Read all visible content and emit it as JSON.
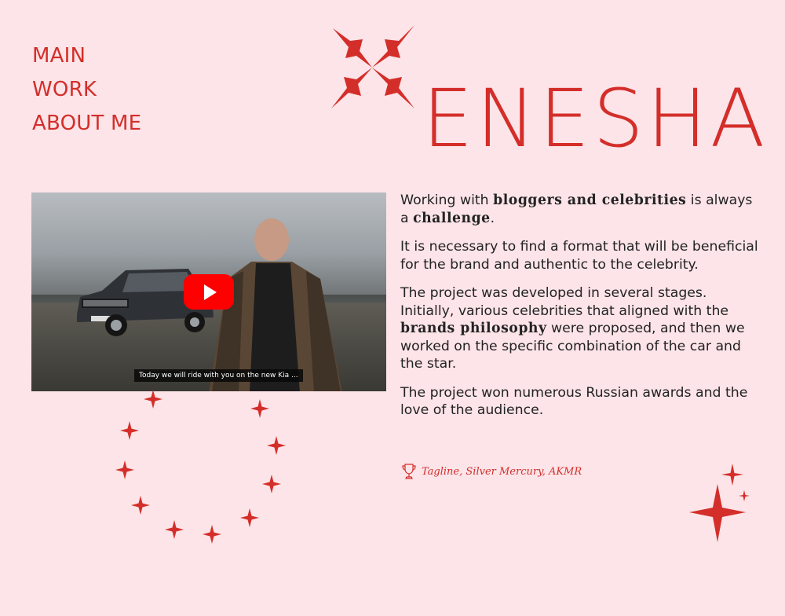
{
  "nav": {
    "items": [
      "MAIN",
      "WORK",
      "ABOUT ME"
    ]
  },
  "logo": {
    "text": "ENESHA",
    "icon": "four-sparkles-icon"
  },
  "video": {
    "caption": "Today we will ride with you on the new Kia ...",
    "play_icon": "youtube-play-icon"
  },
  "body": {
    "p1": {
      "a": "Working with ",
      "b": "bloggers and celebrities",
      "c": " is always a ",
      "d": "challenge",
      "e": "."
    },
    "p2": "It is necessary to find a format that will be beneficial for the brand and authentic to the celebrity.",
    "p3": {
      "a": "The project was developed in several stages. Initially, various celebrities that aligned with the ",
      "b": "brands philosophy",
      "c": " were proposed, and then we worked on the specific combination of the car and the star."
    },
    "p4": "The project won numerous Russian awards and the love of the audience."
  },
  "award": {
    "icon": "trophy-icon",
    "text": "Tagline, Silver Mercury, AKMR"
  },
  "colors": {
    "background": "#fce4e8",
    "accent": "#d42e2a",
    "text": "#232323"
  }
}
